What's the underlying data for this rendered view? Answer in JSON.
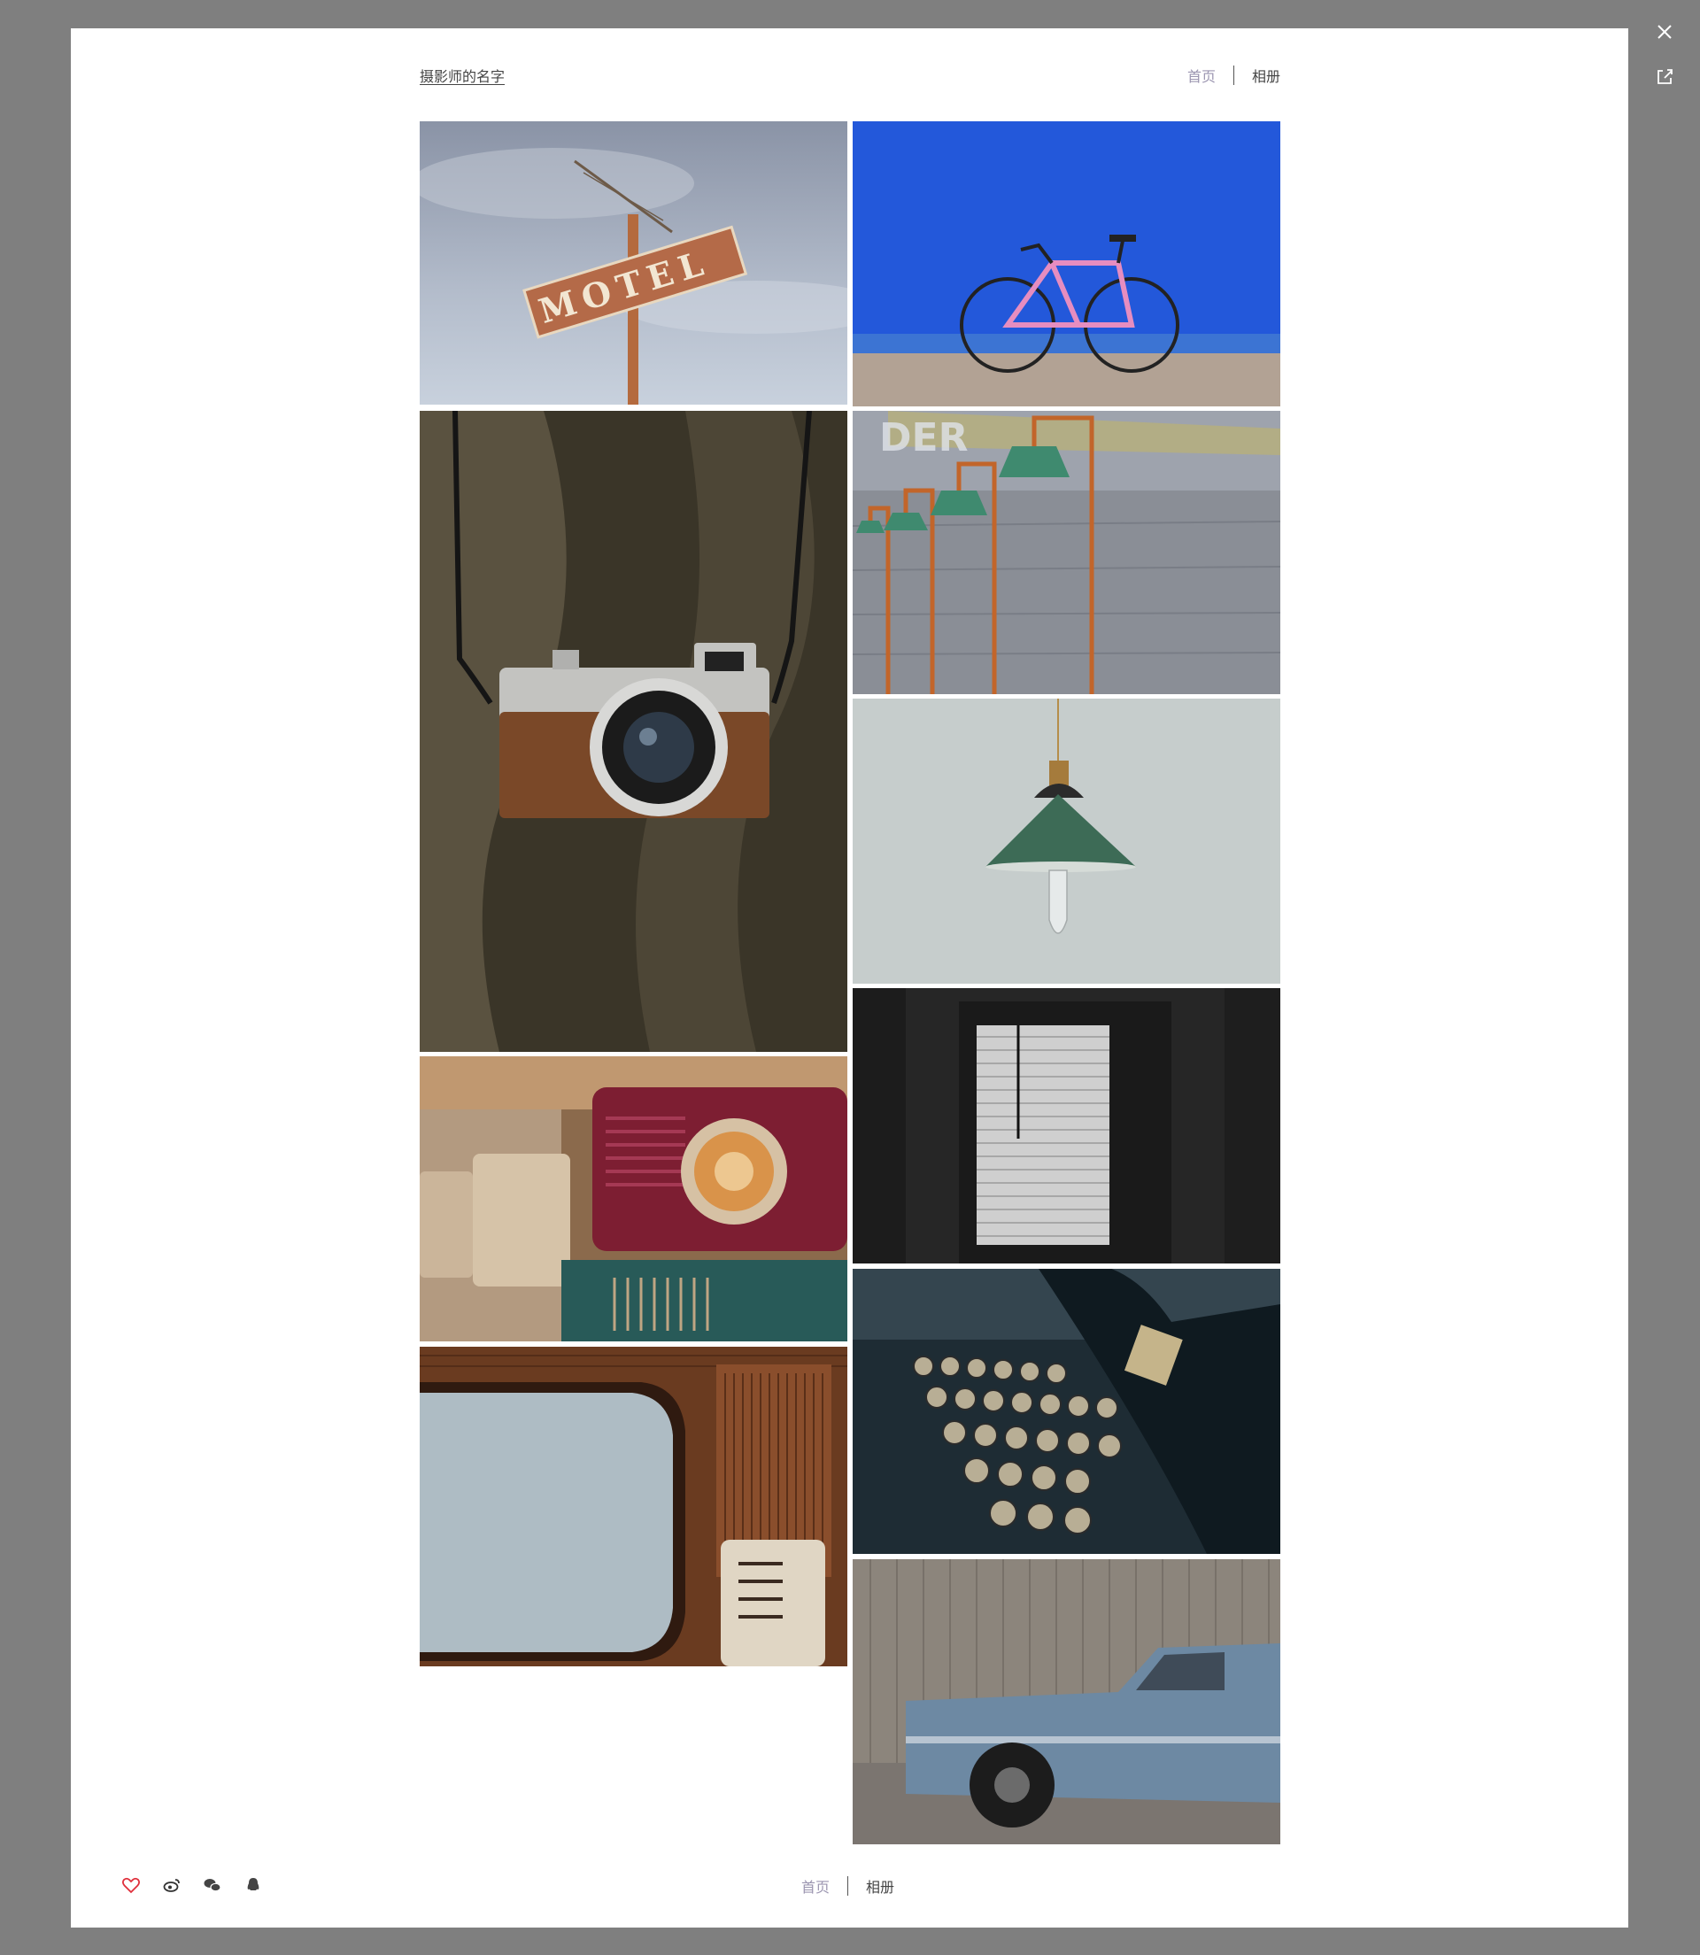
{
  "header": {
    "photographer_name": "摄影师的名字",
    "nav": {
      "home_label": "首页",
      "album_label": "相册"
    }
  },
  "footer": {
    "nav": {
      "home_label": "首页",
      "album_label": "相册"
    },
    "actions": [
      "heart-icon",
      "weibo-icon",
      "wechat-icon",
      "qq-icon"
    ]
  },
  "photos": [
    {
      "subject": "motel sign"
    },
    {
      "subject": "pink bicycle against blue wall"
    },
    {
      "subject": "vintage camera on strap"
    },
    {
      "subject": "wall lamps on grey wall"
    },
    {
      "subject": "green pendant lamp"
    },
    {
      "subject": "window with blinds"
    },
    {
      "subject": "vintage radios"
    },
    {
      "subject": "typewriter keys"
    },
    {
      "subject": "vintage television"
    },
    {
      "subject": "old blue car"
    }
  ],
  "colors": {
    "overlay": "#7f7f7f",
    "modal": "#ffffff",
    "nav_active": "#9b95b0",
    "like": "#e0303c"
  }
}
